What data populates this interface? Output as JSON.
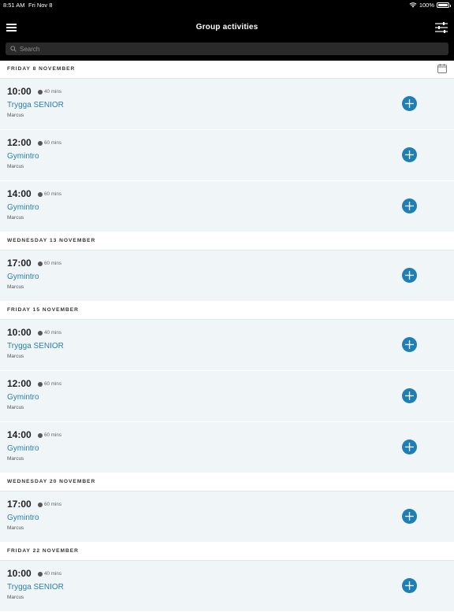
{
  "status": {
    "time": "8:51 AM",
    "date": "Fri Nov 8",
    "battery": "100%"
  },
  "nav": {
    "title": "Group activities",
    "menu_icon": "hamburger-menu-icon",
    "filter_icon": "filter-sliders-icon"
  },
  "search": {
    "placeholder": "Search"
  },
  "days": [
    {
      "label": "FRIDAY 8 NOVEMBER",
      "activities": [
        {
          "time": "10:00",
          "duration": "40 mins",
          "name": "Trygga SENIOR",
          "instructor": "Marcus"
        },
        {
          "time": "12:00",
          "duration": "60 mins",
          "name": "Gymintro",
          "instructor": "Marcus"
        },
        {
          "time": "14:00",
          "duration": "60 mins",
          "name": "Gymintro",
          "instructor": "Marcus"
        }
      ]
    },
    {
      "label": "WEDNESDAY 13 NOVEMBER",
      "activities": [
        {
          "time": "17:00",
          "duration": "60 mins",
          "name": "Gymintro",
          "instructor": "Marcus"
        }
      ]
    },
    {
      "label": "FRIDAY 15 NOVEMBER",
      "activities": [
        {
          "time": "10:00",
          "duration": "40 mins",
          "name": "Trygga SENIOR",
          "instructor": "Marcus"
        },
        {
          "time": "12:00",
          "duration": "60 mins",
          "name": "Gymintro",
          "instructor": "Marcus"
        },
        {
          "time": "14:00",
          "duration": "60 mins",
          "name": "Gymintro",
          "instructor": "Marcus"
        }
      ]
    },
    {
      "label": "WEDNESDAY 20 NOVEMBER",
      "activities": [
        {
          "time": "17:00",
          "duration": "60 mins",
          "name": "Gymintro",
          "instructor": "Marcus"
        }
      ]
    },
    {
      "label": "FRIDAY 22 NOVEMBER",
      "activities": [
        {
          "time": "10:00",
          "duration": "40 mins",
          "name": "Trygga SENIOR",
          "instructor": "Marcus"
        }
      ]
    }
  ],
  "colors": {
    "accent": "#1f7fb3",
    "link": "#2a7fb0",
    "row_bg": "#f0f5f7",
    "header_bg": "#000000"
  }
}
